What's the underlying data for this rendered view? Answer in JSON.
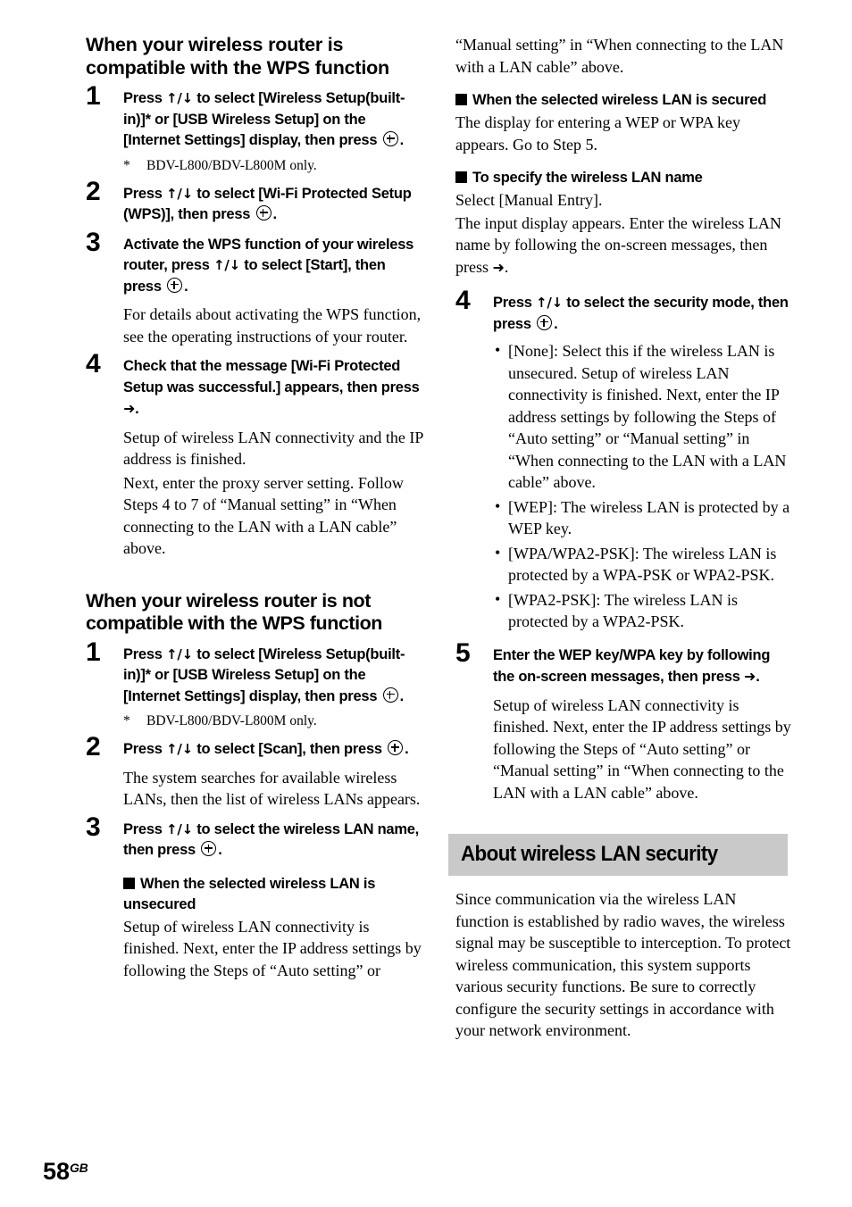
{
  "page": {
    "number": "58",
    "region_code": "GB"
  },
  "glyphs": {
    "up_down_arrows": "↑/↓",
    "right_arrow": "➜",
    "enter_button": "enter-circle-plus",
    "square_bullet": "■",
    "dot_bullet": "•",
    "footnote_mark": "*"
  },
  "left_column": {
    "section1": {
      "heading": "When your wireless router is compatible with the WPS function",
      "steps": [
        {
          "number": "1",
          "title_part1": "Press ",
          "title_part2": " to select [Wireless Setup(built-in)]* or [USB Wireless Setup] on the [Internet Settings] display, then press ",
          "title_end": ".",
          "footnote": "BDV-L800/BDV-L800M only."
        },
        {
          "number": "2",
          "title_part1": "Press ",
          "title_part2": " to select [Wi-Fi Protected Setup (WPS)], then press ",
          "title_end": "."
        },
        {
          "number": "3",
          "title_part1": "Activate the WPS function of your wireless router, press ",
          "title_part2": " to select [Start], then press ",
          "title_end": ".",
          "body": [
            "For details about activating the WPS function, see the operating instructions of your router."
          ]
        },
        {
          "number": "4",
          "title_part1": "Check that the message [Wi-Fi Protected Setup was successful.] appears, then press ",
          "title_end": ".",
          "body": [
            "Setup of wireless LAN connectivity and the IP address is finished.",
            "Next, enter the proxy server setting. Follow Steps 4 to 7 of “Manual setting” in “When connecting to the LAN with a LAN cable” above."
          ]
        }
      ]
    },
    "section2": {
      "heading": "When your wireless router is not compatible with the WPS function",
      "steps": [
        {
          "number": "1",
          "title_part1": "Press ",
          "title_part2": " to select [Wireless Setup(built-in)]* or [USB Wireless Setup] on the [Internet Settings] display, then press ",
          "title_end": ".",
          "footnote": "BDV-L800/BDV-L800M only."
        },
        {
          "number": "2",
          "title_part1": "Press ",
          "title_part2": " to select [Scan], then press ",
          "title_end": ".",
          "body": [
            "The system searches for available wireless LANs, then the list of wireless LANs appears."
          ]
        },
        {
          "number": "3",
          "title_part1": "Press ",
          "title_part2": " to select the wireless LAN name, then press ",
          "title_end": ".",
          "subsection": {
            "heading": "When the selected wireless LAN is unsecured",
            "body": "Setup of wireless LAN connectivity is finished. Next, enter the IP address settings by following the Steps of “Auto setting” or"
          }
        }
      ]
    }
  },
  "right_column": {
    "continued_paragraph": "“Manual setting” in “When connecting to the LAN with a LAN cable” above.",
    "subsections": [
      {
        "heading": "When the selected wireless LAN is secured",
        "body": "The display for entering a WEP or WPA key appears. Go to Step 5."
      },
      {
        "heading": "To specify the wireless LAN name",
        "body_lines": [
          "Select [Manual Entry].",
          "The input display appears. Enter the wireless LAN name by following the on-screen messages, then press "
        ],
        "body_end": "."
      }
    ],
    "steps": [
      {
        "number": "4",
        "title_part1": "Press ",
        "title_part2": " to select the security mode, then press ",
        "title_end": ".",
        "bullets": [
          "[None]: Select this if the wireless LAN is unsecured. Setup of wireless LAN connectivity is finished. Next, enter the IP address settings by following the Steps of “Auto setting” or “Manual setting” in “When connecting to the LAN with a LAN cable” above.",
          "[WEP]: The wireless LAN is protected by a WEP key.",
          "[WPA/WPA2-PSK]: The wireless LAN is protected by a WPA-PSK or WPA2-PSK.",
          "[WPA2-PSK]: The wireless LAN is protected by a WPA2-PSK."
        ]
      },
      {
        "number": "5",
        "title_part1": "Enter the WEP key/WPA key by following the on-screen messages, then press ",
        "title_end": ".",
        "body": [
          "Setup of wireless LAN connectivity is finished. Next, enter the IP address settings by following the Steps of “Auto setting” or “Manual setting” in “When connecting to the LAN with a LAN cable” above."
        ]
      }
    ],
    "gray_section": {
      "title": "About wireless LAN security",
      "body": "Since communication via the wireless LAN function is established by radio waves, the wireless signal may be susceptible to interception. To protect wireless communication, this system supports various security functions. Be sure to correctly configure the security settings in accordance with your network environment."
    }
  },
  "colors": {
    "gray_bar_background": "#c9c9c9",
    "text": "#000000",
    "page_background": "#ffffff"
  }
}
